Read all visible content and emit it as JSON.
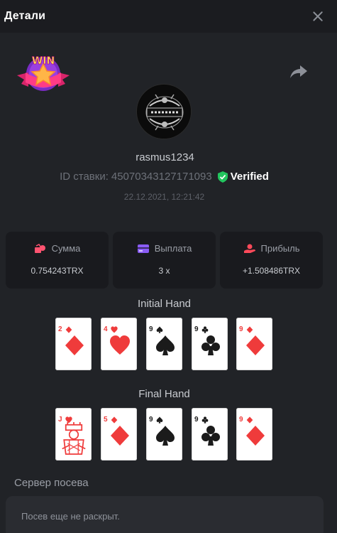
{
  "header": {
    "title": "Детали",
    "close_icon": "close-icon"
  },
  "badge": {
    "text": "WIN",
    "icon": "win-star-badge-icon"
  },
  "share_icon": "share-arrow-icon",
  "player": {
    "avatar": "avatar",
    "username": "rasmus1234",
    "bet_id_label": "ID ставки:",
    "bet_id": "45070343127171093",
    "verified_label": "Verified",
    "timestamp": "22.12.2021, 12:21:42"
  },
  "stats": [
    {
      "label": "Сумма",
      "value": "0.754243TRX",
      "icon": "coins-icon",
      "color": "#ff5370"
    },
    {
      "label": "Выплата",
      "value": "3 x",
      "icon": "wallet-icon",
      "color": "#8a5cf6"
    },
    {
      "label": "Прибыль",
      "value": "+1.508486TRX",
      "icon": "hand-coin-icon",
      "color": "#ff4a5a"
    }
  ],
  "initial_hand": {
    "title": "Initial Hand",
    "cards": [
      {
        "rank": "2",
        "suit": "diamond"
      },
      {
        "rank": "4",
        "suit": "heart"
      },
      {
        "rank": "9",
        "suit": "spade"
      },
      {
        "rank": "9",
        "suit": "club"
      },
      {
        "rank": "9",
        "suit": "diamond"
      }
    ]
  },
  "final_hand": {
    "title": "Final Hand",
    "cards": [
      {
        "rank": "J",
        "suit": "heart"
      },
      {
        "rank": "5",
        "suit": "diamond"
      },
      {
        "rank": "9",
        "suit": "spade"
      },
      {
        "rank": "9",
        "suit": "club"
      },
      {
        "rank": "9",
        "suit": "diamond"
      }
    ]
  },
  "seed": {
    "title": "Сервер посева",
    "value": "Посев еще не раскрыт."
  },
  "colors": {
    "background": "#212327",
    "header": "#1b1c20",
    "card_panel": "#191a1e",
    "verified_shield": "#22c55e",
    "red_suit": "#ef3b3b"
  }
}
